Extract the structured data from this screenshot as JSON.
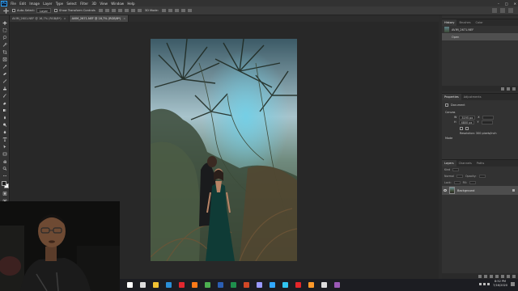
{
  "app": {
    "logo": "Ps",
    "menu": [
      "File",
      "Edit",
      "Image",
      "Layer",
      "Type",
      "Select",
      "Filter",
      "3D",
      "View",
      "Window",
      "Help"
    ],
    "window_controls": [
      "–",
      "□",
      "✕"
    ]
  },
  "options": {
    "auto_select_label": "Auto-Select:",
    "auto_select_value": "Layer",
    "transform_label": "Show Transform Controls",
    "mode_label": "3D Mode:"
  },
  "tabs": [
    {
      "label": "AVIM_2601.NEF @ 16,7% (RGB/8*)",
      "close": "×",
      "active": false
    },
    {
      "label": "AVIM_2671.NEF @ 16,7% (RGB/8*)",
      "close": "×",
      "active": true
    }
  ],
  "toolbar": {
    "tools": [
      "move-tool-icon",
      "marquee-tool-icon",
      "lasso-tool-icon",
      "quick-select-tool-icon",
      "crop-tool-icon",
      "frame-tool-icon",
      "eyedropper-tool-icon",
      "healing-brush-tool-icon",
      "brush-tool-icon",
      "clone-stamp-tool-icon",
      "history-brush-tool-icon",
      "eraser-tool-icon",
      "gradient-tool-icon",
      "blur-tool-icon",
      "dodge-tool-icon",
      "pen-tool-icon",
      "type-tool-icon",
      "path-select-tool-icon",
      "rectangle-tool-icon",
      "hand-tool-icon",
      "zoom-tool-icon",
      "more-tools-icon"
    ]
  },
  "history_panel": {
    "tabs": [
      "History",
      "Brushes",
      "Color"
    ],
    "snapshot": "AVIM_2671.NEF",
    "steps": [
      "Open"
    ]
  },
  "properties_panel": {
    "tabs": [
      "Properties",
      "Adjustments"
    ],
    "doc_label": "Document",
    "canvas_label": "Canvas",
    "width_label": "W",
    "width_value": "3195 px",
    "height_label": "H",
    "height_value": "4800 px",
    "x_label": "X",
    "y_label": "Y",
    "resolution": "Resolution: 300 pixels/inch",
    "mode": "Mode"
  },
  "layers_panel": {
    "tabs": [
      "Layers",
      "Channels",
      "Paths"
    ],
    "kind_label": "Kind",
    "blend_mode": "Normal",
    "opacity_label": "Opacity:",
    "fill_label": "Fill:",
    "lock_label": "Lock:",
    "layer_name": "Background"
  },
  "taskbar": {
    "icons": [
      {
        "name": "start-icon",
        "color": "#ffffff"
      },
      {
        "name": "search-icon",
        "color": "#dddddd"
      },
      {
        "name": "file-explorer-icon",
        "color": "#f2c233"
      },
      {
        "name": "edge-icon",
        "color": "#2a8fd8"
      },
      {
        "name": "opera-icon",
        "color": "#e3272f"
      },
      {
        "name": "firefox-icon",
        "color": "#ff7a18"
      },
      {
        "name": "chrome-icon",
        "color": "#4caf50"
      },
      {
        "name": "word-icon",
        "color": "#2b5fb4"
      },
      {
        "name": "excel-icon",
        "color": "#1f8f4d"
      },
      {
        "name": "powerpoint-icon",
        "color": "#d24726"
      },
      {
        "name": "premiere-icon",
        "color": "#9999ff"
      },
      {
        "name": "photoshop-icon",
        "color": "#31a8ff"
      },
      {
        "name": "lightroom-icon",
        "color": "#31c5f0"
      },
      {
        "name": "acrobat-icon",
        "color": "#e4262a"
      },
      {
        "name": "media-icon",
        "color": "#ff9a2a"
      },
      {
        "name": "obs-icon",
        "color": "#dddddd"
      },
      {
        "name": "settings-icon",
        "color": "#9b59b6"
      }
    ],
    "time": "8:52 PM",
    "date": "7/16/2020"
  },
  "colors": {
    "accent": "#31a8ff",
    "foreground_swatch": "#1e1e1e",
    "background_swatch": "#ffffff"
  }
}
